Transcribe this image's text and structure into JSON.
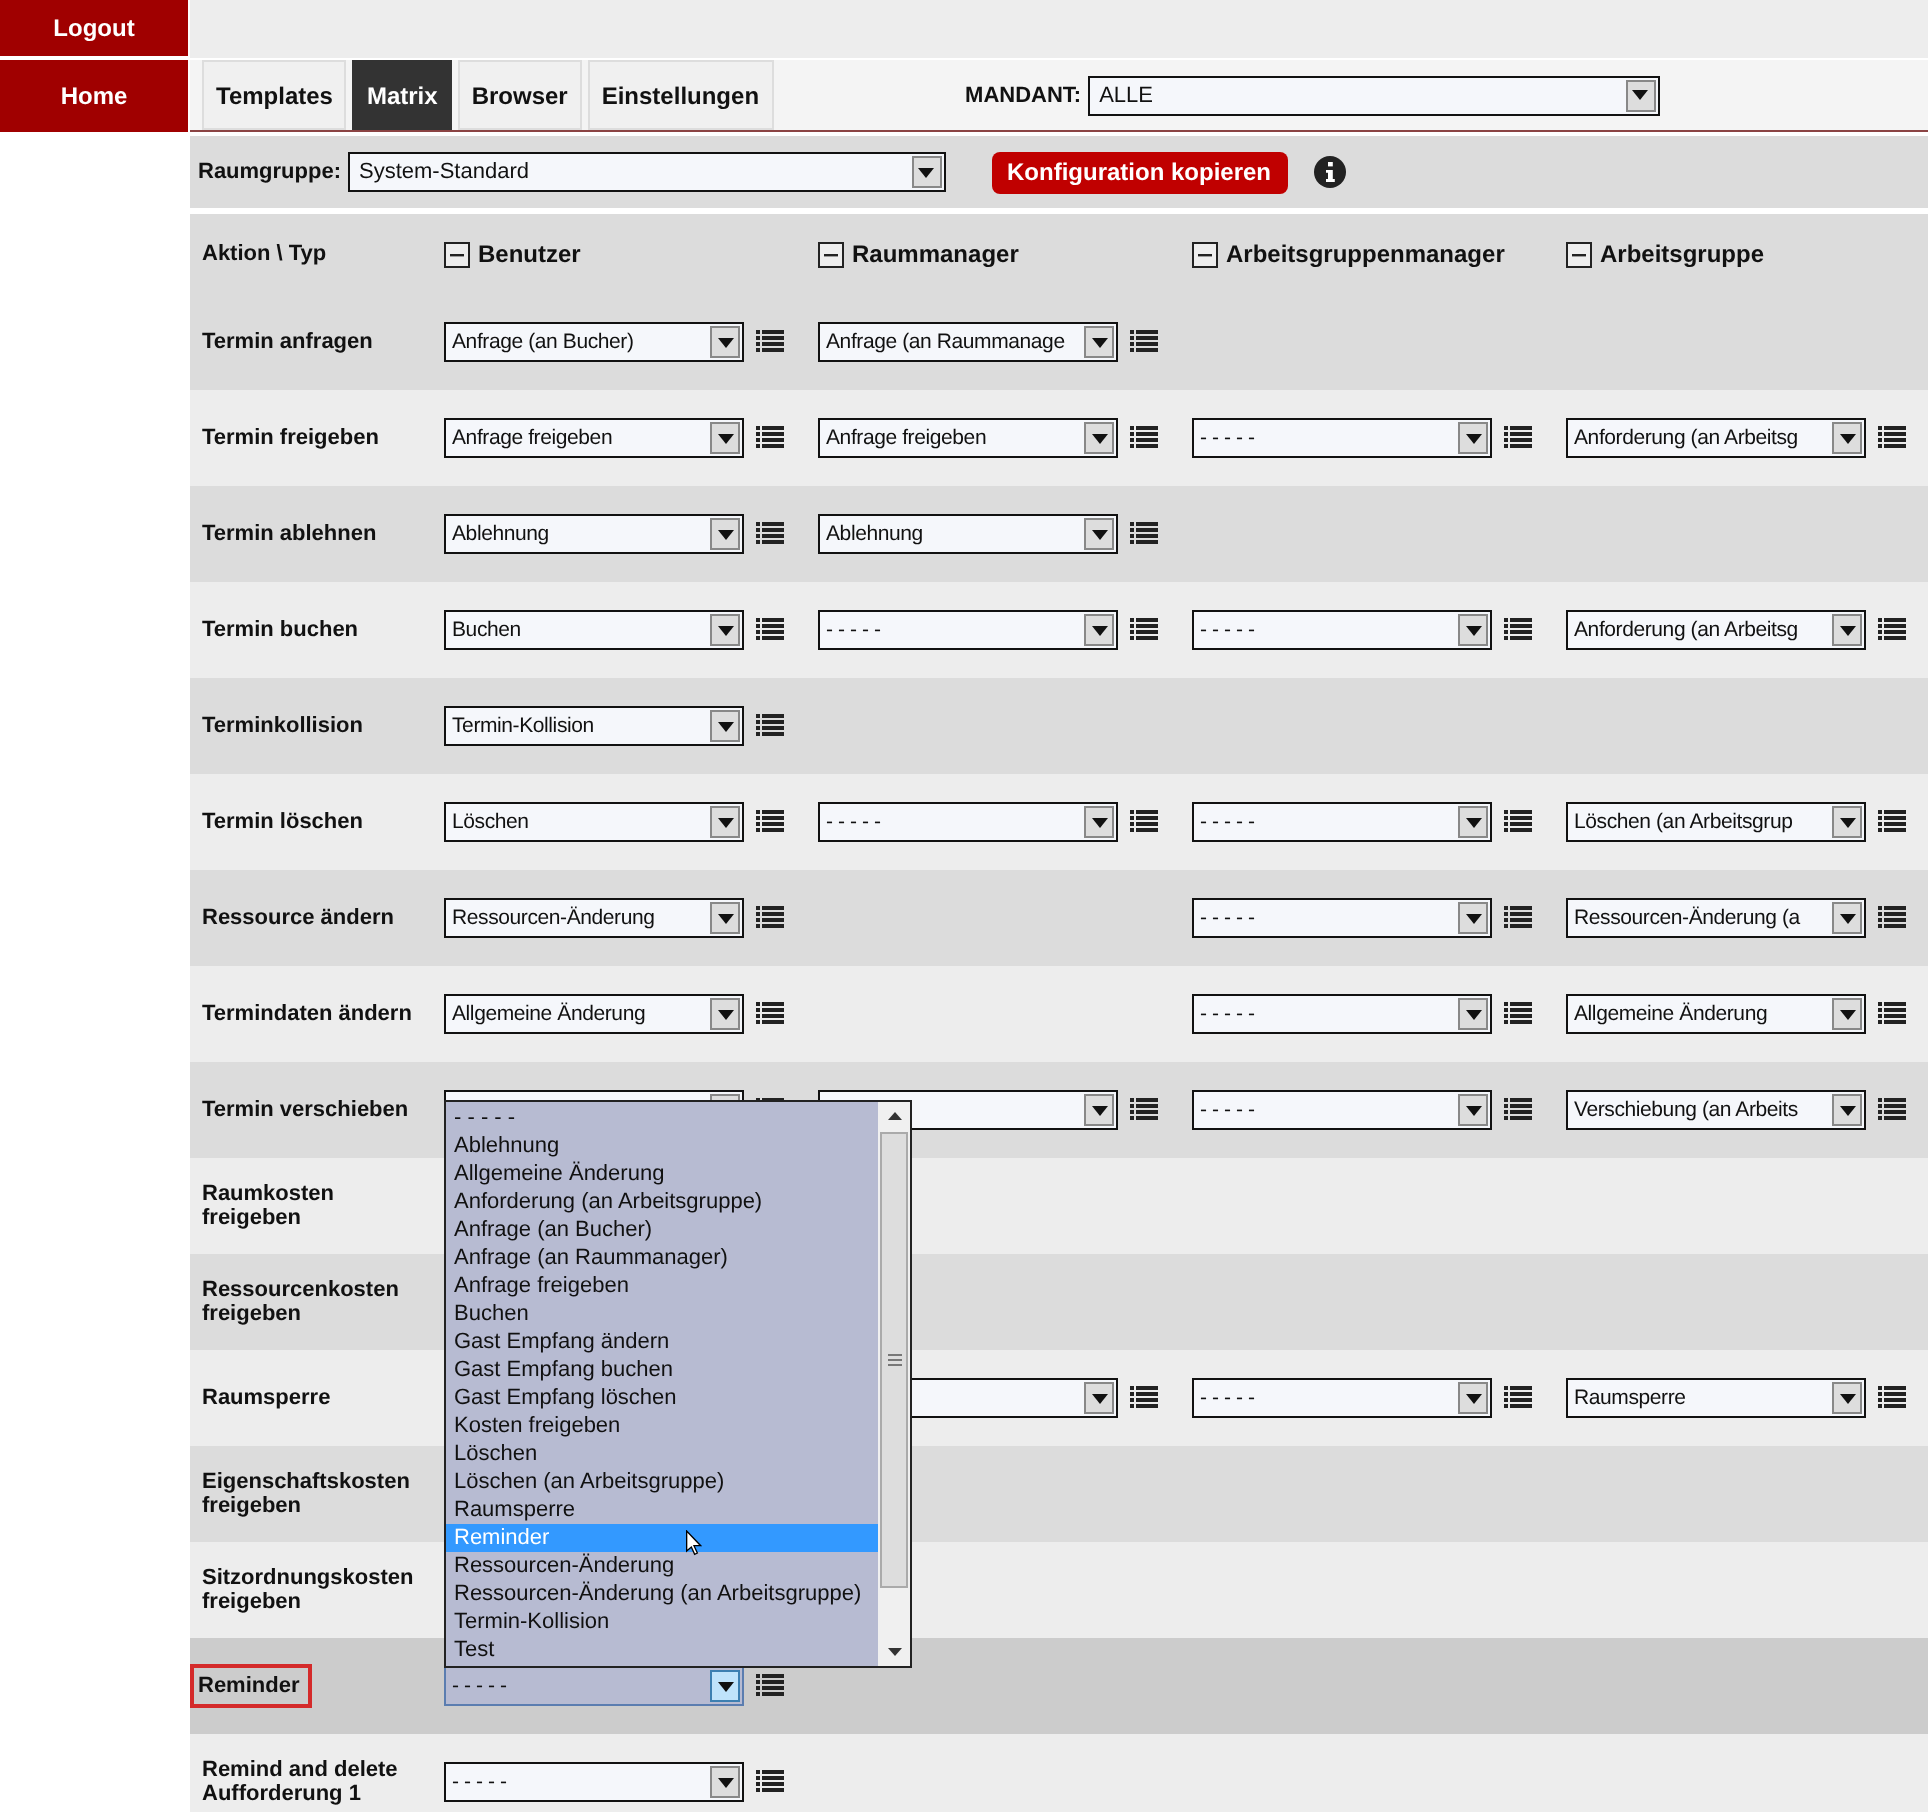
{
  "sidebar": {
    "buttons": [
      "Logout",
      "Home"
    ]
  },
  "tabs": [
    {
      "label": "Templates",
      "selected": false
    },
    {
      "label": "Matrix",
      "selected": true
    },
    {
      "label": "Browser",
      "selected": false
    },
    {
      "label": "Einstellungen",
      "selected": false
    }
  ],
  "mandant": {
    "label": "MANDANT:",
    "value": "ALLE"
  },
  "raumgruppe": {
    "label": "Raumgruppe:",
    "value": "System-Standard"
  },
  "copy_button": "Konfiguration kopieren",
  "matrix": {
    "corner": "Aktion \\ Typ",
    "columns": [
      {
        "label": "Benutzer",
        "expanded": true
      },
      {
        "label": "Raummanager",
        "expanded": true
      },
      {
        "label": "Arbeitsgruppenmanager",
        "expanded": true
      },
      {
        "label": "Arbeitsgruppe",
        "expanded": true
      }
    ],
    "rows": [
      {
        "label": "Termin anfragen",
        "highlighted": false,
        "cells": [
          {
            "kind": "select",
            "value": "Anfrage (an Bucher)",
            "focused": false
          },
          {
            "kind": "select",
            "value": "Anfrage (an Raummanage",
            "focused": false
          },
          {
            "kind": "none"
          },
          {
            "kind": "none"
          }
        ]
      },
      {
        "label": "Termin freigeben",
        "highlighted": false,
        "cells": [
          {
            "kind": "select",
            "value": "Anfrage freigeben",
            "focused": false
          },
          {
            "kind": "select",
            "value": "Anfrage freigeben",
            "focused": false
          },
          {
            "kind": "select",
            "value": "- - - - -",
            "focused": false
          },
          {
            "kind": "select",
            "value": "Anforderung (an Arbeitsg",
            "focused": false
          }
        ]
      },
      {
        "label": "Termin ablehnen",
        "highlighted": false,
        "cells": [
          {
            "kind": "select",
            "value": "Ablehnung",
            "focused": false
          },
          {
            "kind": "select",
            "value": "Ablehnung",
            "focused": false
          },
          {
            "kind": "none"
          },
          {
            "kind": "none"
          }
        ]
      },
      {
        "label": "Termin buchen",
        "highlighted": false,
        "cells": [
          {
            "kind": "select",
            "value": "Buchen",
            "focused": false
          },
          {
            "kind": "select",
            "value": "- - - - -",
            "focused": false
          },
          {
            "kind": "select",
            "value": "- - - - -",
            "focused": false
          },
          {
            "kind": "select",
            "value": "Anforderung (an Arbeitsg",
            "focused": false
          }
        ]
      },
      {
        "label": "Terminkollision",
        "highlighted": false,
        "cells": [
          {
            "kind": "select",
            "value": "Termin-Kollision",
            "focused": false
          },
          {
            "kind": "none"
          },
          {
            "kind": "none"
          },
          {
            "kind": "none"
          }
        ]
      },
      {
        "label": "Termin löschen",
        "highlighted": false,
        "cells": [
          {
            "kind": "select",
            "value": "Löschen",
            "focused": false
          },
          {
            "kind": "select",
            "value": "- - - - -",
            "focused": false
          },
          {
            "kind": "select",
            "value": "- - - - -",
            "focused": false
          },
          {
            "kind": "select",
            "value": "Löschen (an Arbeitsgrup",
            "focused": false
          }
        ]
      },
      {
        "label": "Ressource ändern",
        "highlighted": false,
        "cells": [
          {
            "kind": "select",
            "value": "Ressourcen-Änderung",
            "focused": false
          },
          {
            "kind": "none"
          },
          {
            "kind": "select",
            "value": "- - - - -",
            "focused": false
          },
          {
            "kind": "select",
            "value": "Ressourcen-Änderung (a",
            "focused": false
          }
        ]
      },
      {
        "label": "Termindaten ändern",
        "highlighted": false,
        "cells": [
          {
            "kind": "select",
            "value": "Allgemeine Änderung",
            "focused": false
          },
          {
            "kind": "none"
          },
          {
            "kind": "select",
            "value": "- - - - -",
            "focused": false
          },
          {
            "kind": "select",
            "value": "Allgemeine Änderung",
            "focused": false
          }
        ]
      },
      {
        "label": "Termin verschieben",
        "highlighted": false,
        "cells": [
          {
            "kind": "select",
            "focused": false
          },
          {
            "kind": "select",
            "focused": false
          },
          {
            "kind": "select",
            "value": "- - - - -",
            "focused": false
          },
          {
            "kind": "select",
            "value": "Verschiebung (an Arbeits",
            "focused": false
          }
        ]
      },
      {
        "label": "Raumkosten freigeben",
        "highlighted": false,
        "cells": [
          {
            "kind": "none"
          },
          {
            "kind": "none"
          },
          {
            "kind": "none"
          },
          {
            "kind": "none"
          }
        ]
      },
      {
        "label": "Ressourcenkosten freigeben",
        "highlighted": false,
        "cells": [
          {
            "kind": "none"
          },
          {
            "kind": "none"
          },
          {
            "kind": "none"
          },
          {
            "kind": "none"
          }
        ]
      },
      {
        "label": "Raumsperre",
        "highlighted": false,
        "cells": [
          {
            "kind": "none"
          },
          {
            "kind": "select",
            "focused": false
          },
          {
            "kind": "select",
            "value": "- - - - -",
            "focused": false
          },
          {
            "kind": "select",
            "value": "Raumsperre",
            "focused": false
          }
        ]
      },
      {
        "label": "Eigenschaftskosten freigeben",
        "highlighted": false,
        "cells": [
          {
            "kind": "none"
          },
          {
            "kind": "none"
          },
          {
            "kind": "none"
          },
          {
            "kind": "none"
          }
        ]
      },
      {
        "label": "Sitzordnungskosten freigeben",
        "highlighted": false,
        "cells": [
          {
            "kind": "none"
          },
          {
            "kind": "none"
          },
          {
            "kind": "none"
          },
          {
            "kind": "none"
          }
        ]
      },
      {
        "label": "Reminder",
        "highlighted": true,
        "cells": [
          {
            "kind": "select",
            "value": "- - - - -",
            "focused": true
          },
          {
            "kind": "none"
          },
          {
            "kind": "none"
          },
          {
            "kind": "none"
          }
        ]
      },
      {
        "label": "Remind and delete Aufforderung 1",
        "highlighted": false,
        "cells": [
          {
            "kind": "select",
            "value": "- - - - -",
            "focused": false
          },
          {
            "kind": "none"
          },
          {
            "kind": "none"
          },
          {
            "kind": "none"
          }
        ]
      }
    ]
  },
  "open_dropdown": {
    "options": [
      {
        "label": "- - - - -",
        "selected": false
      },
      {
        "label": "Ablehnung",
        "selected": false
      },
      {
        "label": "Allgemeine Änderung",
        "selected": false
      },
      {
        "label": "Anforderung (an Arbeitsgruppe)",
        "selected": false
      },
      {
        "label": "Anfrage (an Bucher)",
        "selected": false
      },
      {
        "label": "Anfrage (an Raummanager)",
        "selected": false
      },
      {
        "label": "Anfrage freigeben",
        "selected": false
      },
      {
        "label": "Buchen",
        "selected": false
      },
      {
        "label": "Gast Empfang ändern",
        "selected": false
      },
      {
        "label": "Gast Empfang buchen",
        "selected": false
      },
      {
        "label": "Gast Empfang löschen",
        "selected": false
      },
      {
        "label": "Kosten freigeben",
        "selected": false
      },
      {
        "label": "Löschen",
        "selected": false
      },
      {
        "label": "Löschen (an Arbeitsgruppe)",
        "selected": false
      },
      {
        "label": "Raumsperre",
        "selected": false
      },
      {
        "label": "Reminder",
        "selected": true
      },
      {
        "label": "Ressourcen-Änderung",
        "selected": false
      },
      {
        "label": "Ressourcen-Änderung (an Arbeitsgruppe)",
        "selected": false
      },
      {
        "label": "Termin-Kollision",
        "selected": false
      },
      {
        "label": "Test",
        "selected": false
      }
    ]
  }
}
